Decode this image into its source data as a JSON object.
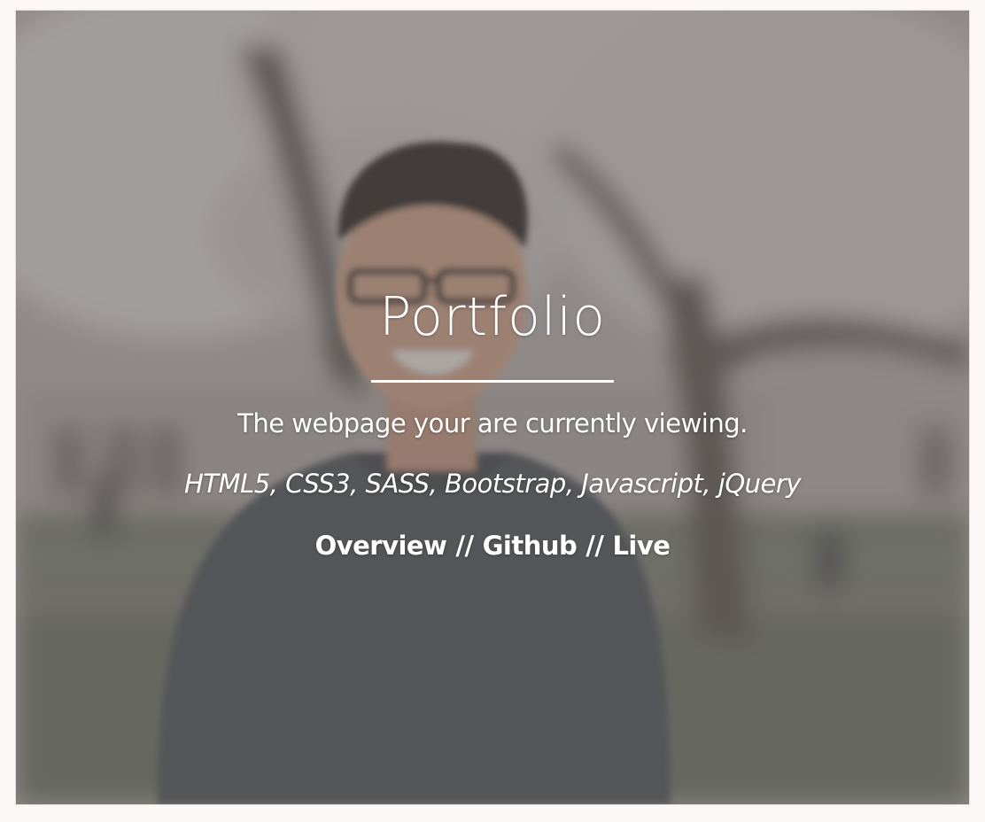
{
  "project": {
    "title": "Portfolio",
    "description": "The webpage your are currently viewing.",
    "technologies": "HTML5, CSS3, SASS, Bootstrap, Javascript, jQuery"
  },
  "links": {
    "overview": "Overview",
    "separator": "//",
    "github": "Github",
    "live": "Live"
  },
  "colors": {
    "page_background": "#fcf8f7",
    "overlay_text": "#ffffff",
    "overlay_tint": "#6f6a68"
  },
  "icons": {
    "background": "person-photo"
  }
}
